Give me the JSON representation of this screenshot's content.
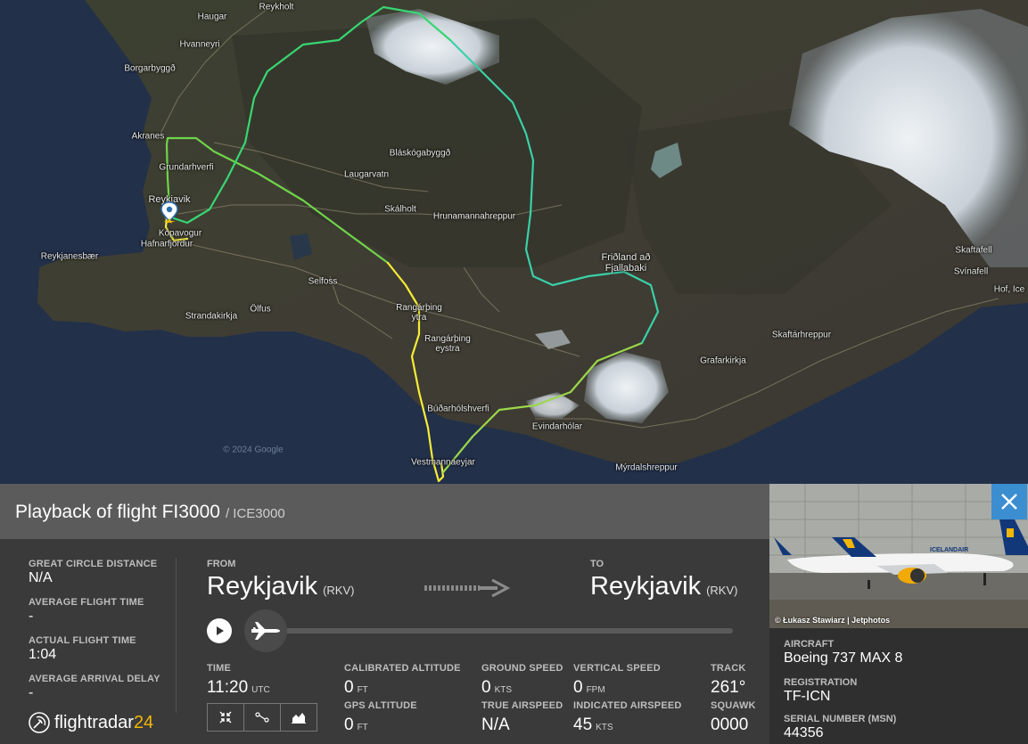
{
  "map": {
    "places": [
      {
        "name": "Haugar"
      },
      {
        "name": "Reykholt"
      },
      {
        "name": "Hvanneyri"
      },
      {
        "name": "Borgarbyggð"
      },
      {
        "name": "Akranes"
      },
      {
        "name": "Grundarhverfi"
      },
      {
        "name": "Reykjavik"
      },
      {
        "name": "Kópavogur"
      },
      {
        "name": "Hafnarfjordur"
      },
      {
        "name": "Reykjanesbær"
      },
      {
        "name": "Strandakirkja"
      },
      {
        "name": "Ölfus"
      },
      {
        "name": "Selfoss"
      },
      {
        "name": "Laugarvatn"
      },
      {
        "name": "Bláskógabyggð"
      },
      {
        "name": "Skálholt"
      },
      {
        "name": "Hrunamannahreppur"
      },
      {
        "name": "Rangárþing ytra"
      },
      {
        "name": "Rangárþing eystra"
      },
      {
        "name": "Friðland að Fjallabaki"
      },
      {
        "name": "Skaftárhreppur"
      },
      {
        "name": "Grafarkirkja"
      },
      {
        "name": "Skaftafell"
      },
      {
        "name": "Svínafell"
      },
      {
        "name": "Hof, Ice"
      },
      {
        "name": "Búðarhólshverfi"
      },
      {
        "name": "Evindarhólar"
      },
      {
        "name": "Vestmannaeyjar"
      },
      {
        "name": "Mýrdalshreppur"
      },
      {
        "name": "© 2024 Google"
      }
    ]
  },
  "panel": {
    "title": "Playback of flight FI3000",
    "callsign": "/ ICE3000",
    "great_circle_label": "GREAT CIRCLE DISTANCE",
    "great_circle_value": "N/A",
    "avg_flight_time_label": "AVERAGE FLIGHT TIME",
    "avg_flight_time_value": "-",
    "actual_flight_time_label": "ACTUAL FLIGHT TIME",
    "actual_flight_time_value": "1:04",
    "avg_arrival_delay_label": "AVERAGE ARRIVAL DELAY",
    "avg_arrival_delay_value": "-",
    "from_label": "FROM",
    "from_city": "Reykjavik",
    "from_code": "(RKV)",
    "to_label": "TO",
    "to_city": "Reykjavik",
    "to_code": "(RKV)",
    "playback_progress": 0,
    "time_label": "TIME",
    "time_value": "11:20",
    "time_unit": "UTC",
    "cal_alt_label": "CALIBRATED ALTITUDE",
    "cal_alt_value": "0",
    "cal_alt_unit": "FT",
    "gps_alt_label": "GPS ALTITUDE",
    "gps_alt_value": "0",
    "gps_alt_unit": "FT",
    "ground_speed_label": "GROUND SPEED",
    "ground_speed_value": "0",
    "ground_speed_unit": "KTS",
    "true_airspeed_label": "TRUE AIRSPEED",
    "true_airspeed_value": "N/A",
    "vertical_speed_label": "VERTICAL SPEED",
    "vertical_speed_value": "0",
    "vertical_speed_unit": "FPM",
    "ias_label": "INDICATED AIRSPEED",
    "ias_value": "45",
    "ias_unit": "KTS",
    "track_label": "TRACK",
    "track_value": "261°",
    "squawk_label": "SQUAWK",
    "squawk_value": "0000",
    "brand_prefix": "flightradar",
    "brand_suffix": "24"
  },
  "card": {
    "photo_credit": "© Łukasz Stawiarz | Jetphotos",
    "livery_text": "ICELANDAIR",
    "aircraft_label": "AIRCRAFT",
    "aircraft_value": "Boeing 737 MAX 8",
    "registration_label": "REGISTRATION",
    "registration_value": "TF-ICN",
    "serial_label": "SERIAL NUMBER (MSN)",
    "serial_value": "44356"
  },
  "colors": {
    "route_start": "#ffee33",
    "route_mid": "#2ee08a",
    "route_far": "#35c9c0",
    "brand_accent": "#f2b705",
    "close_button": "#3b8ed0"
  }
}
